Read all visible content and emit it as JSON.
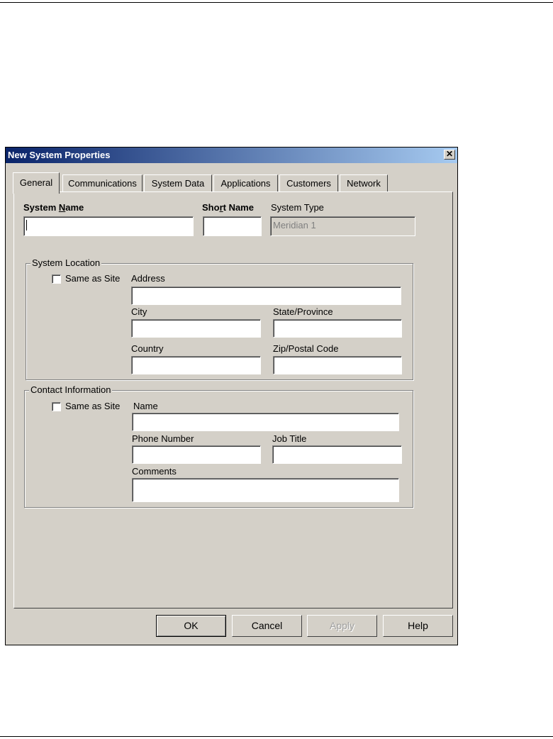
{
  "window": {
    "title": "New System Properties",
    "close_glyph": "✕"
  },
  "tabs": [
    "General",
    "Communications",
    "System Data",
    "Applications",
    "Customers",
    "Network"
  ],
  "general": {
    "system_name_label_pre": "System ",
    "system_name_label_key": "N",
    "system_name_label_post": "ame",
    "system_name_value": "",
    "short_name_label_pre": "Sho",
    "short_name_label_key": "r",
    "short_name_label_post": "t Name",
    "short_name_value": "",
    "system_type_label": "System Type",
    "system_type_value": "Meridian 1"
  },
  "location": {
    "group_label": "System Location",
    "same_as_site": "Same as Site",
    "address_label": "Address",
    "city_label": "City",
    "state_label": "State/Province",
    "country_label": "Country",
    "zip_label": "Zip/Postal Code"
  },
  "contact": {
    "group_label": "Contact Information",
    "same_as_site": "Same as Site",
    "name_label": "Name",
    "phone_label": "Phone Number",
    "job_label": "Job Title",
    "comments_label": "Comments"
  },
  "buttons": {
    "ok": "OK",
    "cancel": "Cancel",
    "apply": "Apply",
    "help": "Help"
  }
}
